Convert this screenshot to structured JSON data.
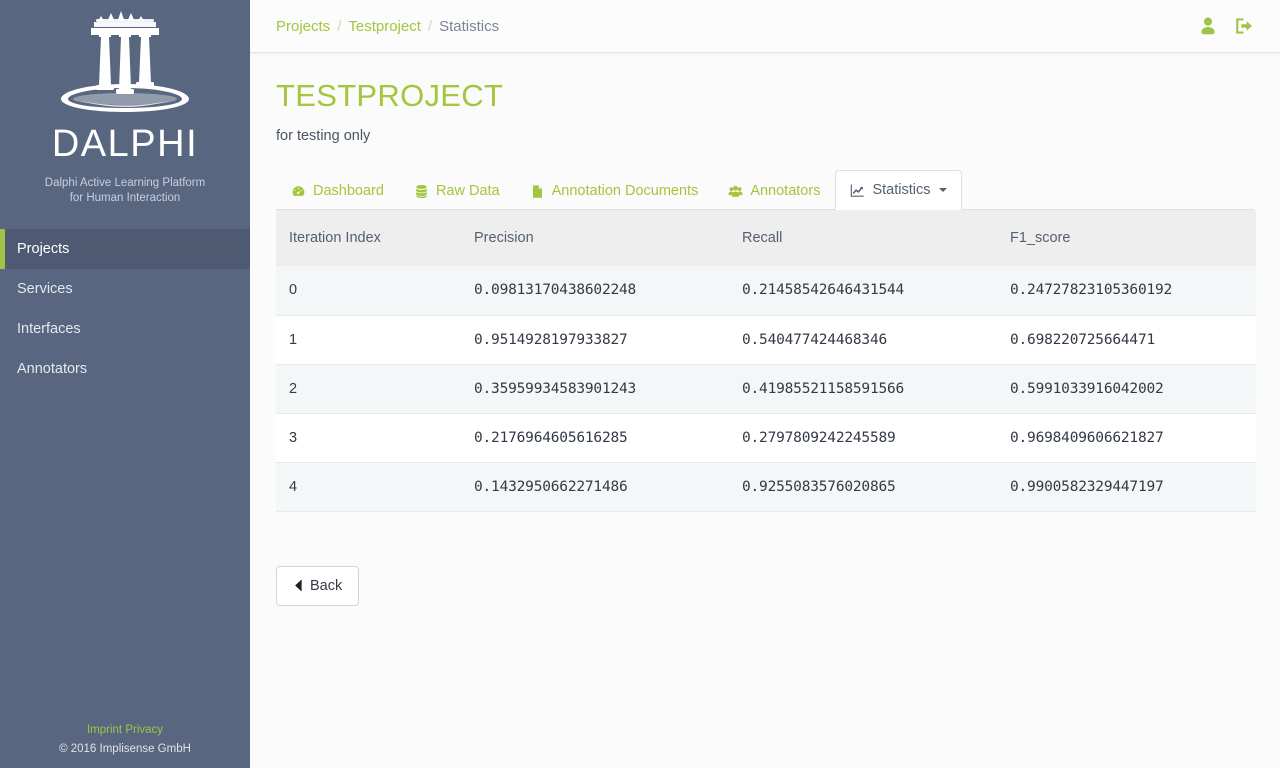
{
  "sidebar": {
    "brand_name": "DALPHI",
    "tagline_line1": "Dalphi Active Learning Platform",
    "tagline_line2": "for Human Interaction",
    "logo_icon": "greek-temple-icon",
    "items": [
      {
        "label": "Projects",
        "active": true
      },
      {
        "label": "Services",
        "active": false
      },
      {
        "label": "Interfaces",
        "active": false
      },
      {
        "label": "Annotators",
        "active": false
      }
    ],
    "footer": {
      "imprint_label": "Imprint",
      "privacy_label": "Privacy",
      "copyright": "© 2016 Implisense GmbH"
    }
  },
  "topbar": {
    "breadcrumb": [
      {
        "label": "Projects",
        "link": true
      },
      {
        "label": "Testproject",
        "link": true
      },
      {
        "label": "Statistics",
        "link": false
      }
    ],
    "separator": "/",
    "actions": [
      {
        "icon": "user-icon",
        "name": "account"
      },
      {
        "icon": "sign-out-icon",
        "name": "logout"
      }
    ]
  },
  "page": {
    "title": "TESTPROJECT",
    "subtitle": "for testing only"
  },
  "tabs": [
    {
      "label": "Dashboard",
      "icon": "tachometer-icon",
      "active": false,
      "caret": false
    },
    {
      "label": "Raw Data",
      "icon": "database-icon",
      "active": false,
      "caret": false
    },
    {
      "label": "Annotation Documents",
      "icon": "file-icon",
      "active": false,
      "caret": false
    },
    {
      "label": "Annotators",
      "icon": "users-icon",
      "active": false,
      "caret": false
    },
    {
      "label": "Statistics",
      "icon": "line-chart-icon",
      "active": true,
      "caret": true
    }
  ],
  "table": {
    "columns": [
      "Iteration Index",
      "Precision",
      "Recall",
      "F1_score"
    ],
    "rows": [
      {
        "index": "0",
        "precision": "0.09813170438602248",
        "recall": "0.21458542646431544",
        "f1": "0.24727823105360192"
      },
      {
        "index": "1",
        "precision": "0.9514928197933827",
        "recall": "0.540477424468346",
        "f1": "0.698220725664471"
      },
      {
        "index": "2",
        "precision": "0.35959934583901243",
        "recall": "0.41985521158591566",
        "f1": "0.5991033916042002"
      },
      {
        "index": "3",
        "precision": "0.2176964605616285",
        "recall": "0.2797809242245589",
        "f1": "0.9698409606621827"
      },
      {
        "index": "4",
        "precision": "0.1432950662271486",
        "recall": "0.9255083576020865",
        "f1": "0.9900582329447197"
      }
    ]
  },
  "back_button": {
    "label": "Back",
    "icon": "chevron-left-icon"
  },
  "colors": {
    "brand_green": "#a4c63f",
    "sidebar_bg": "#586680",
    "sidebar_active_bg": "#4d5a72",
    "accent_bar": "#a0c447",
    "content_bg": "#fafbfa",
    "table_header_bg": "#eeeeee",
    "table_stripe_bg": "#f4f7f8"
  }
}
